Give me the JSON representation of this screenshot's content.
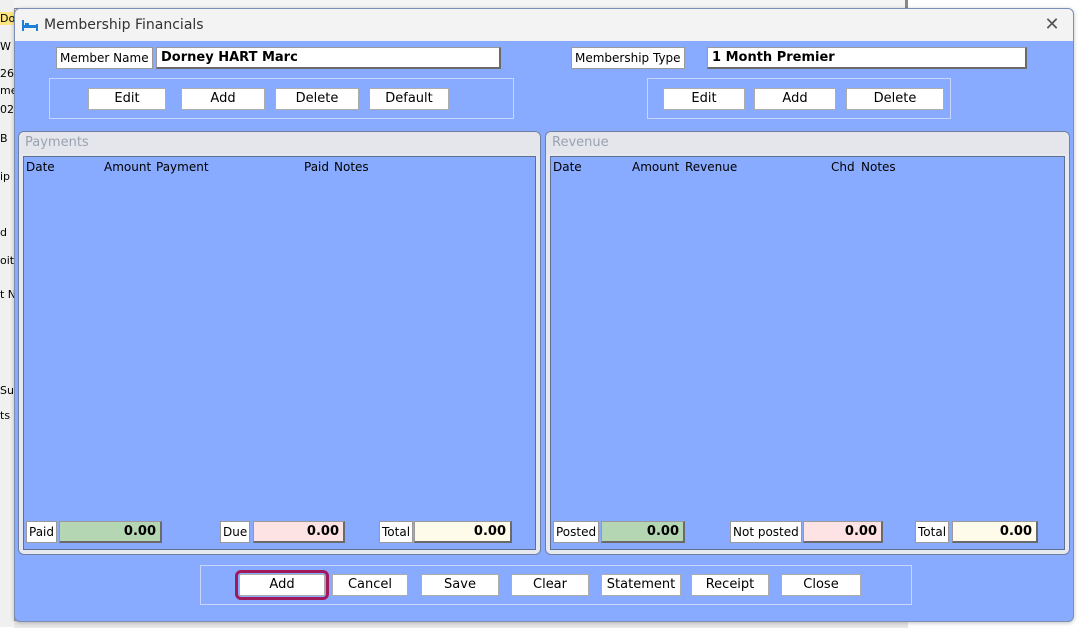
{
  "background_app": {
    "fragments": [
      "Do",
      "W",
      "26",
      "me",
      "02",
      "B",
      "ip",
      "d",
      "oit",
      "t N",
      "Su",
      "ts"
    ]
  },
  "window": {
    "title": "Membership Financials",
    "icon": "bed-icon",
    "close_glyph": "✕"
  },
  "member": {
    "name_label": "Member Name",
    "name_value": "Dorney HART Marc",
    "type_label": "Membership Type",
    "type_value": "1 Month Premier"
  },
  "member_buttons": [
    "Edit",
    "Add",
    "Delete",
    "Default"
  ],
  "type_buttons": [
    "Edit",
    "Add",
    "Delete"
  ],
  "payments": {
    "title": "Payments",
    "columns": [
      "Date",
      "Amount",
      "Payment",
      "Paid",
      "Notes"
    ],
    "rows": [],
    "totals": [
      {
        "label": "Paid",
        "value": "0.00",
        "color": "#b5d6b2"
      },
      {
        "label": "Due",
        "value": "0.00",
        "color": "#fde3e3"
      },
      {
        "label": "Total",
        "value": "0.00",
        "color": "#fffbeb"
      }
    ]
  },
  "revenue": {
    "title": "Revenue",
    "columns": [
      "Date",
      "Amount",
      "Revenue",
      "Chd",
      "Notes"
    ],
    "rows": [],
    "totals": [
      {
        "label": "Posted",
        "value": "0.00",
        "color": "#b5d6b2"
      },
      {
        "label": "Not posted",
        "value": "0.00",
        "color": "#fde3e3"
      },
      {
        "label": "Total",
        "value": "0.00",
        "color": "#fffbeb"
      }
    ]
  },
  "action_buttons": [
    "Add",
    "Cancel",
    "Save",
    "Clear",
    "Statement",
    "Receipt",
    "Close"
  ],
  "colors": {
    "window_bg": "#88aaff",
    "highlight": "#a0195a"
  }
}
